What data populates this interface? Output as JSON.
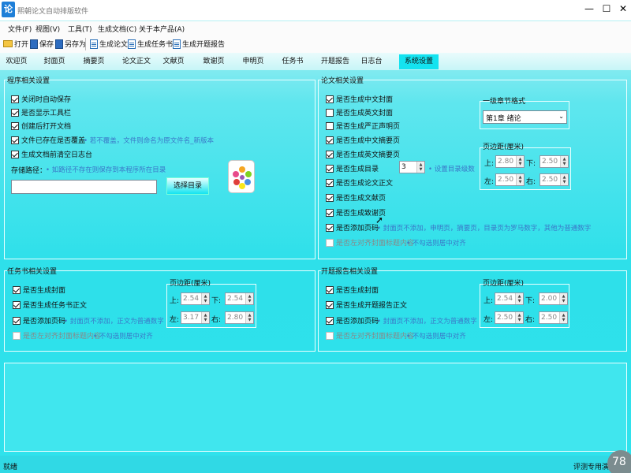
{
  "window": {
    "title": "熙朝论文自动排版软件",
    "minimize": "—",
    "maximize": "☐",
    "close": "✕"
  },
  "menu": [
    "文件(F)",
    "视图(V)",
    "工具(T)",
    "生成文档(C)",
    "关于本产品(A)"
  ],
  "toolbar": {
    "open": "打开",
    "save": "保存",
    "save_as": "另存为",
    "gen_paper": "生成论文",
    "gen_task": "生成任务书",
    "gen_report": "生成开题报告"
  },
  "tabs": [
    "欢迎页",
    "封面页",
    "摘要页",
    "论文正文",
    "文献页",
    "致谢页",
    "申明页",
    "任务书",
    "开题报告",
    "日志台",
    "系统设置"
  ],
  "program": {
    "title": "程序相关设置",
    "options": [
      {
        "label": "关闭时自动保存",
        "checked": true
      },
      {
        "label": "是否显示工具栏",
        "checked": true
      },
      {
        "label": "创建后打开文档",
        "checked": true
      },
      {
        "label": "文件已存在是否覆盖",
        "checked": true
      },
      {
        "label": "生成文档前清空日志台",
        "checked": true
      }
    ],
    "overwrite_hint": "若不覆盖，文件则命名为原文件名_新版本",
    "save_path_label": "存储路径：",
    "save_path_hint": "如路径不存在则保存到本程序所在目录",
    "save_path_value": "",
    "choose_dir": "选择目录"
  },
  "paper": {
    "title": "论文相关设置",
    "options": [
      {
        "label": "是否生成中文封面",
        "checked": true
      },
      {
        "label": "是否生成英文封面",
        "checked": false
      },
      {
        "label": "是否生成严正声明页",
        "checked": false
      },
      {
        "label": "是否生成中文摘要页",
        "checked": true
      },
      {
        "label": "是否生成英文摘要页",
        "checked": true
      },
      {
        "label": "是否生成目录",
        "checked": true
      },
      {
        "label": "是否生成论文正文",
        "checked": true
      },
      {
        "label": "是否生成文献页",
        "checked": true
      },
      {
        "label": "是否生成致谢页",
        "checked": true
      },
      {
        "label": "是否添加页码",
        "checked": true
      },
      {
        "label": "是否左对齐封面标题内容",
        "checked": false,
        "disabled": true
      }
    ],
    "toc_levels": "3",
    "toc_hint": "设置目录级数",
    "page_hint": "封面页不添加，申明页，摘要页，目录页为罗马数字，其他为普通数字",
    "align_hint": "不勾选则居中对齐",
    "chapter_label": "一级章节格式",
    "chapter_value": "第1章  绪论",
    "margin_title": "页边距(厘米)",
    "top_label": "上:",
    "bottom_label": "下:",
    "left_label": "左:",
    "right_label": "右:",
    "top": "2.80",
    "bottom": "2.50",
    "left": "2.50",
    "right": "2.50"
  },
  "task": {
    "title": "任务书相关设置",
    "options": [
      {
        "label": "是否生成封面",
        "checked": true
      },
      {
        "label": "是否生成任务书正文",
        "checked": true
      },
      {
        "label": "是否添加页码",
        "checked": true
      },
      {
        "label": "是否左对齐封面标题内容",
        "checked": false,
        "disabled": true
      }
    ],
    "page_hint": "封面页不添加，正文为普通数字",
    "align_hint": "不勾选则居中对齐",
    "margin_title": "页边距(厘米)",
    "top_label": "上:",
    "bottom_label": "下:",
    "left_label": "左:",
    "right_label": "右:",
    "top": "2.54",
    "bottom": "2.54",
    "left": "3.17",
    "right": "2.80"
  },
  "report": {
    "title": "开题报告相关设置",
    "options": [
      {
        "label": "是否生成封面",
        "checked": true
      },
      {
        "label": "是否生成开题报告正文",
        "checked": true
      },
      {
        "label": "是否添加页码",
        "checked": true
      },
      {
        "label": "是否左对齐封面标题内容",
        "checked": false,
        "disabled": true
      }
    ],
    "page_hint": "封面页不添加，正文为普通数字",
    "align_hint": "不勾选则居中对齐",
    "margin_title": "页边距(厘米)",
    "top_label": "上:",
    "bottom_label": "下:",
    "left_label": "左:",
    "right_label": "右:",
    "top": "2.54",
    "bottom": "2.00",
    "left": "2.50",
    "right": "2.50"
  },
  "status": {
    "left": "就绪",
    "right": "评测专用演示",
    "badge": "78"
  },
  "colors": {
    "tab_active": "#14e3f0",
    "hint": "#3a78c8",
    "panel": "#2fe2ec"
  }
}
